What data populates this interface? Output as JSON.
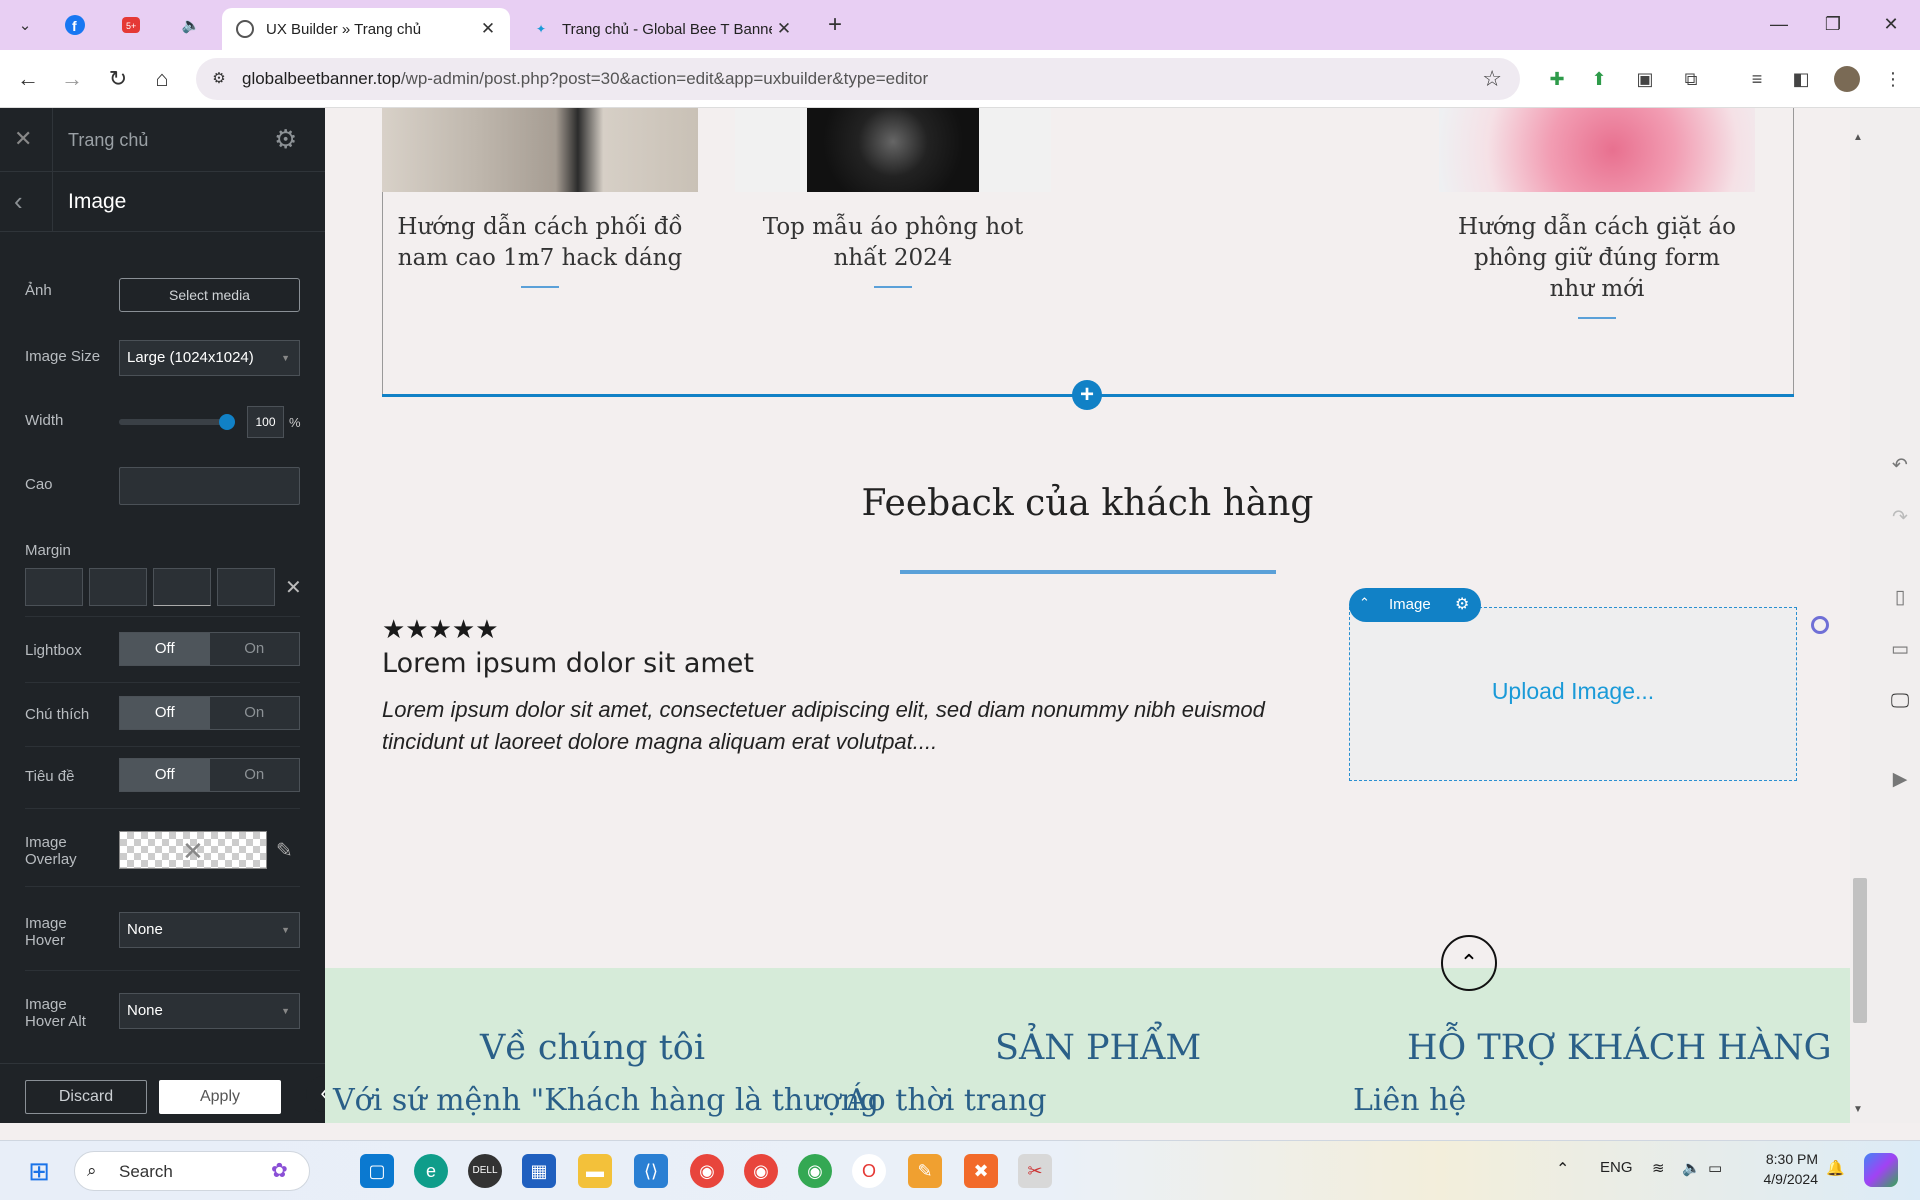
{
  "browser": {
    "tabs": [
      {
        "title": "UX Builder » Trang chủ",
        "active": true
      },
      {
        "title": "Trang chủ - Global Bee T Banne",
        "active": false
      }
    ],
    "url_domain": "globalbeetbanner.top",
    "url_path": "/wp-admin/post.php?post=30&action=edit&app=uxbuilder&type=editor",
    "new_tab_label": "+"
  },
  "panel": {
    "page_title": "Trang chủ",
    "element_title": "Image",
    "fields": {
      "anh_label": "Ảnh",
      "select_media": "Select media",
      "image_size_label": "Image Size",
      "image_size_value": "Large (1024x1024)",
      "width_label": "Width",
      "width_value": "100",
      "width_unit": "%",
      "width_level": 1.0,
      "cao_label": "Cao",
      "margin_label": "Margin",
      "lightbox_label": "Lightbox",
      "chu_thich_label": "Chú thích",
      "tieu_de_label": "Tiêu đề",
      "off": "Off",
      "on": "On",
      "image_overlay_label1": "Image",
      "image_overlay_label2": "Overlay",
      "image_hover_label1": "Image",
      "image_hover_label2": "Hover",
      "image_hover_value": "None",
      "image_hover_alt_label1": "Image",
      "image_hover_alt_label2": "Hover Alt",
      "image_hover_alt_value": "None"
    },
    "discard": "Discard",
    "apply": "Apply"
  },
  "canvas": {
    "posts": [
      {
        "title": "Hướng dẫn cách phối đồ nam cao 1m7 hack dáng"
      },
      {
        "title": "Top mẫu áo phông hot nhất 2024"
      },
      {
        "title": "Hướng dẫn cách giặt áo phông giữ đúng form như mới"
      }
    ],
    "feedback_title": "Feeback của khách hàng",
    "stars": "★★★★★",
    "review_title": "Lorem ipsum dolor sit amet",
    "review_text": "Lorem ipsum dolor sit amet, consectetuer adipiscing elit, sed diam nonummy nibh euismod tincidunt ut laoreet dolore magna aliquam erat volutpat....",
    "image_tag_label": "Image",
    "upload_label": "Upload Image...",
    "footer": {
      "col1_head": "Về chúng tôi",
      "col1_item": "Với sứ mệnh \"Khách hàng là thượng",
      "col2_head": "SẢN PHẨM",
      "col2_item": "Áo thời trang",
      "col3_head": "HỖ TRỢ KHÁCH HÀNG",
      "col3_item": "Liên hệ"
    }
  },
  "taskbar": {
    "search_placeholder": "Search",
    "lang": "ENG",
    "time": "8:30 PM",
    "date": "4/9/2024"
  },
  "colors": {
    "accent": "#1181c6",
    "tabbar": "#e8cff3",
    "panel_bg": "#1f2327",
    "footer_bg": "#d6ebd9",
    "footer_text": "#2a5f88"
  }
}
